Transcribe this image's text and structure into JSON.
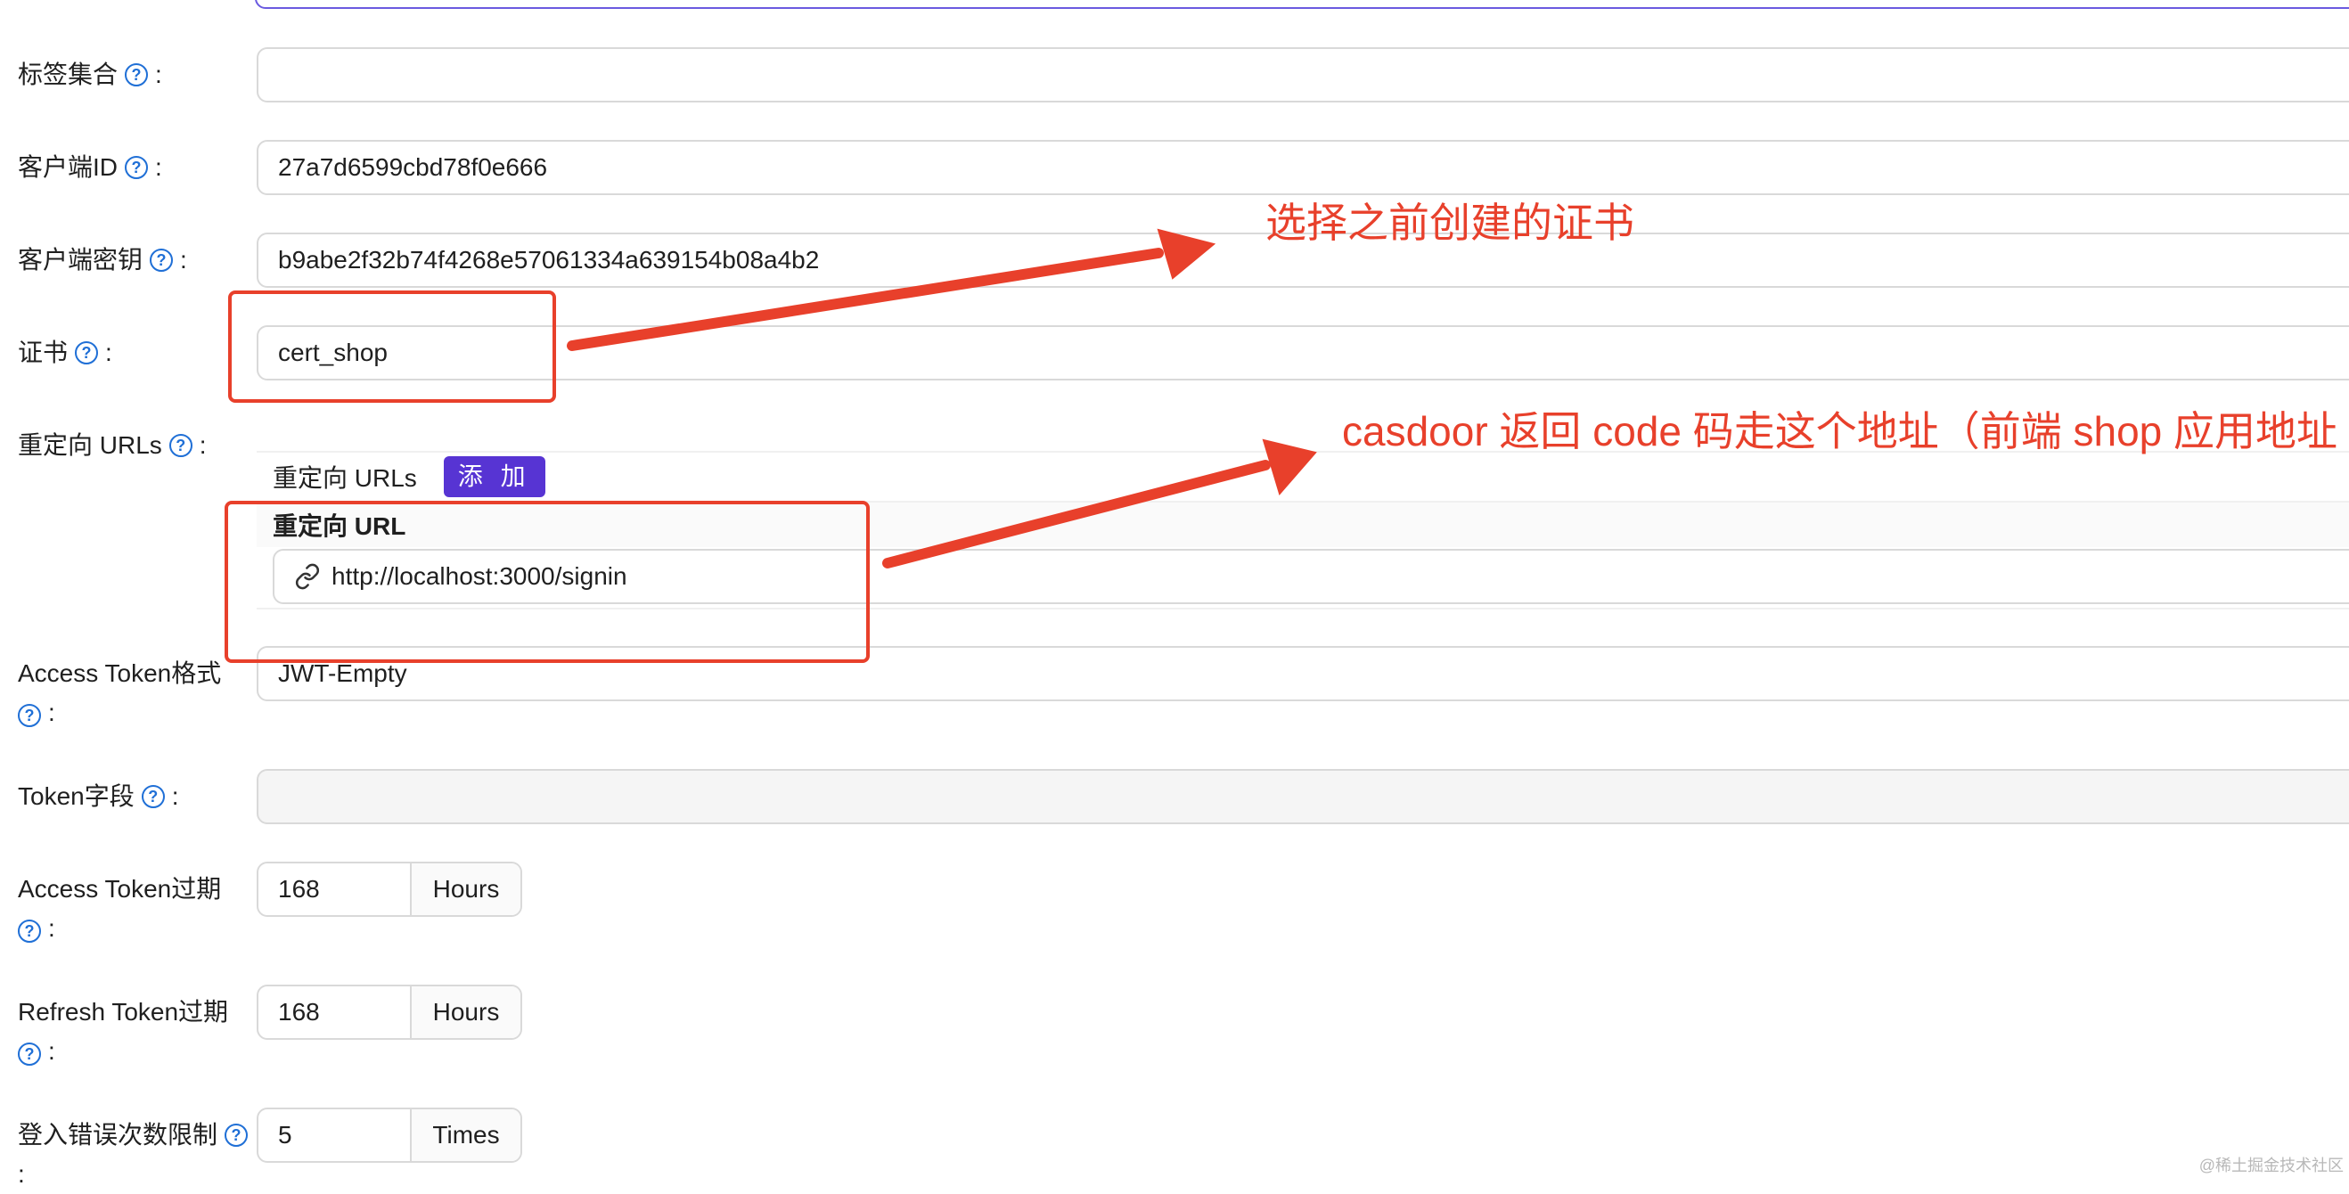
{
  "form": {
    "tags": {
      "label": "标签集合",
      "value": ""
    },
    "client_id": {
      "label": "客户端ID",
      "value": "27a7d6599cbd78f0e666"
    },
    "client_secret": {
      "label": "客户端密钥",
      "value": "b9abe2f32b74f4268e57061334a639154b08a4b2"
    },
    "cert": {
      "label": "证书",
      "value": "cert_shop"
    },
    "redirect_urls": {
      "label": "重定向 URLs",
      "header_title": "重定向 URLs",
      "add_button": "添 加",
      "column_header": "重定向 URL",
      "rows": [
        "http://localhost:3000/signin"
      ]
    },
    "access_token_format": {
      "label": "Access Token格式",
      "value": "JWT-Empty"
    },
    "token_fields": {
      "label": "Token字段",
      "value": ""
    },
    "access_token_expire": {
      "label": "Access Token过期",
      "value": "168",
      "unit": "Hours"
    },
    "refresh_token_expire": {
      "label": "Refresh Token过期",
      "value": "168",
      "unit": "Hours"
    },
    "login_error_limit": {
      "label": "登入错误次数限制",
      "value": "5",
      "unit": "Times"
    }
  },
  "annotations": {
    "cert_note": "选择之前创建的证书",
    "redirect_note": "casdoor 返回 code 码走这个地址（前端 shop 应用地址"
  },
  "colors": {
    "annotation": "#e8402b",
    "add_button": "#5734d3",
    "help_icon": "#1f6fd6"
  },
  "icons": {
    "help": "question-circle-icon",
    "link": "link-icon"
  },
  "watermark": "@稀土掘金技术社区"
}
